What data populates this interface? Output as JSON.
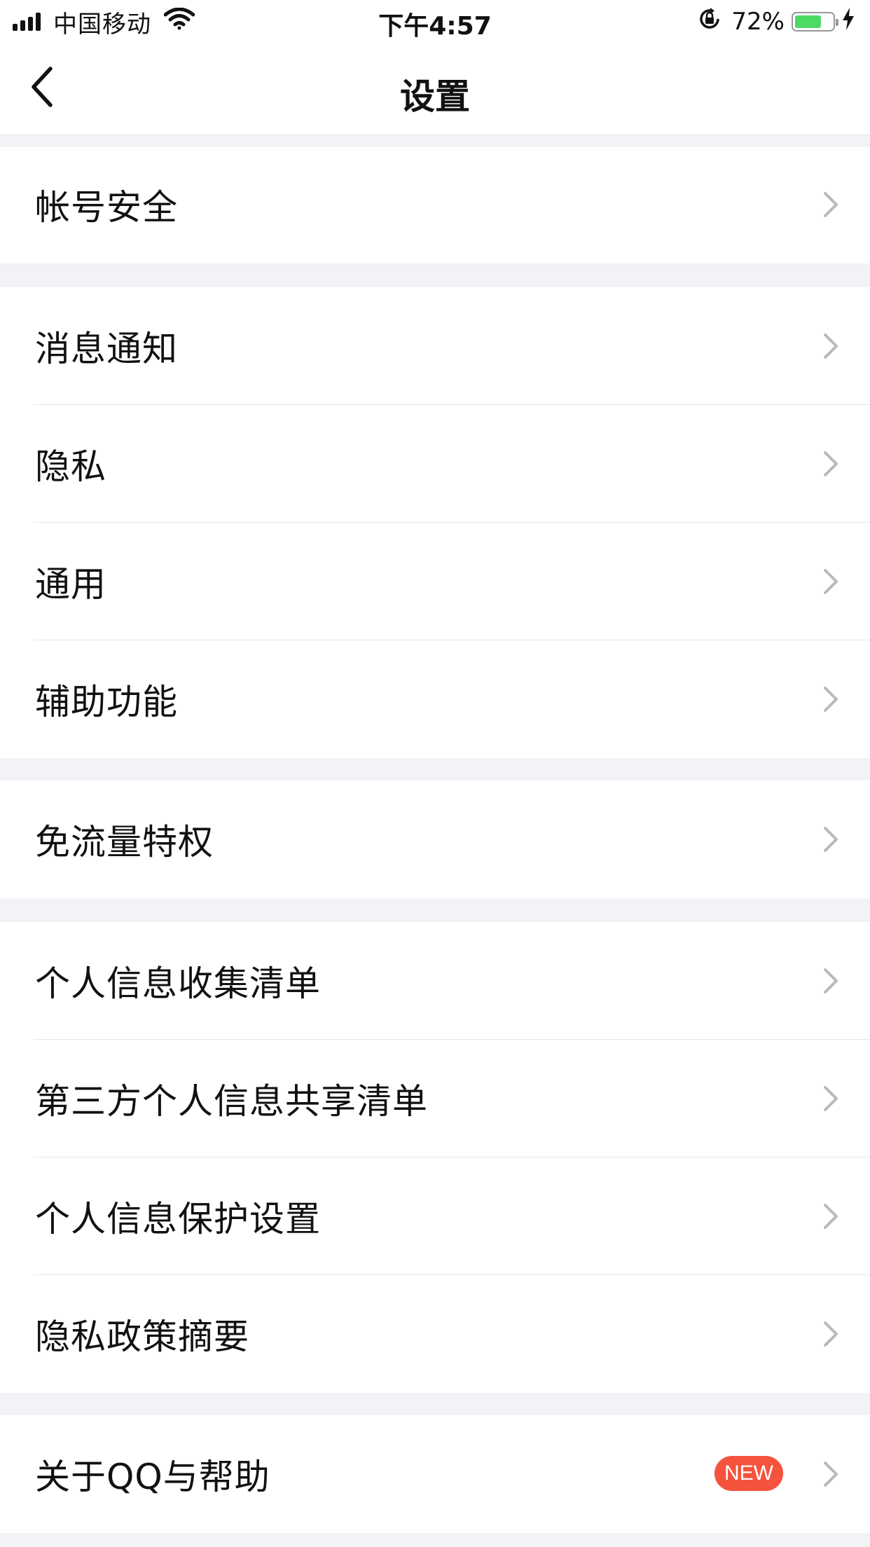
{
  "status_bar": {
    "carrier": "中国移动",
    "time": "下午4:57",
    "battery_percent": "72%",
    "battery_level": 0.72,
    "battery_color": "#4cd964"
  },
  "nav": {
    "title": "设置",
    "back_icon": "chevron-left-icon"
  },
  "sections": [
    {
      "items": [
        {
          "label": "帐号安全"
        }
      ]
    },
    {
      "items": [
        {
          "label": "消息通知"
        },
        {
          "label": "隐私"
        },
        {
          "label": "通用"
        },
        {
          "label": "辅助功能"
        }
      ]
    },
    {
      "items": [
        {
          "label": "免流量特权"
        }
      ]
    },
    {
      "items": [
        {
          "label": "个人信息收集清单"
        },
        {
          "label": "第三方个人信息共享清单"
        },
        {
          "label": "个人信息保护设置"
        },
        {
          "label": "隐私政策摘要"
        }
      ]
    },
    {
      "items": [
        {
          "label": "关于QQ与帮助",
          "badge": "NEW"
        }
      ]
    }
  ],
  "colors": {
    "badge": "#f5533d",
    "chevron": "#b8b8c0",
    "background": "#f2f3f7"
  }
}
